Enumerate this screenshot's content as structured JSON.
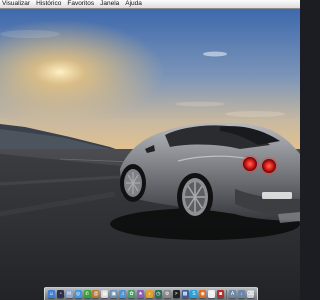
{
  "menubar": {
    "items": [
      {
        "label": "Visualizar"
      },
      {
        "label": "Histórico"
      },
      {
        "label": "Favoritos"
      },
      {
        "label": "Janela"
      },
      {
        "label": "Ajuda"
      }
    ]
  },
  "wallpaper": {
    "subject": "silver sports car driving on road at sunset",
    "sky_color": "#4a77b8",
    "sun_color": "#f5c878"
  },
  "dock": {
    "apps": [
      {
        "name": "finder-icon",
        "color": "#3e7fd8",
        "glyph": "☺"
      },
      {
        "name": "dashboard-icon",
        "color": "#2f2f4a",
        "glyph": "◔"
      },
      {
        "name": "mail-icon",
        "color": "#8fa7c9",
        "glyph": "✉"
      },
      {
        "name": "safari-icon",
        "color": "#3f98e3",
        "glyph": "◎"
      },
      {
        "name": "ichat-icon",
        "color": "#3aa03a",
        "glyph": "✆"
      },
      {
        "name": "address-book-icon",
        "color": "#b5793a",
        "glyph": "@"
      },
      {
        "name": "ical-icon",
        "color": "#d8d8d8",
        "glyph": "▦"
      },
      {
        "name": "preview-icon",
        "color": "#6f8fb0",
        "glyph": "▣"
      },
      {
        "name": "itunes-icon",
        "color": "#4f95d6",
        "glyph": "♫"
      },
      {
        "name": "iphoto-icon",
        "color": "#4a9c6a",
        "glyph": "✿"
      },
      {
        "name": "imovie-icon",
        "color": "#8c5fb4",
        "glyph": "★"
      },
      {
        "name": "garageband-icon",
        "color": "#e0a030",
        "glyph": "♪"
      },
      {
        "name": "time-machine-icon",
        "color": "#2d6e4e",
        "glyph": "◷"
      },
      {
        "name": "system-preferences-icon",
        "color": "#8a8a8a",
        "glyph": "⚙"
      },
      {
        "name": "terminal-icon",
        "color": "#222222",
        "glyph": ">"
      },
      {
        "name": "spaces-icon",
        "color": "#3a5f9a",
        "glyph": "▩"
      },
      {
        "name": "skype-icon",
        "color": "#2a9fd8",
        "glyph": "S"
      },
      {
        "name": "firefox-icon",
        "color": "#e36b1e",
        "glyph": "◉"
      },
      {
        "name": "textedit-icon",
        "color": "#efefef",
        "glyph": "✎"
      },
      {
        "name": "photo-booth-icon",
        "color": "#b52e2e",
        "glyph": "◙"
      }
    ],
    "stacks": [
      {
        "name": "applications-stack-icon",
        "color": "#6c86a8",
        "glyph": "A"
      },
      {
        "name": "downloads-stack-icon",
        "color": "#6c86a8",
        "glyph": "↓"
      },
      {
        "name": "trash-icon",
        "color": "#c8ccd0",
        "glyph": "⌫"
      }
    ]
  }
}
